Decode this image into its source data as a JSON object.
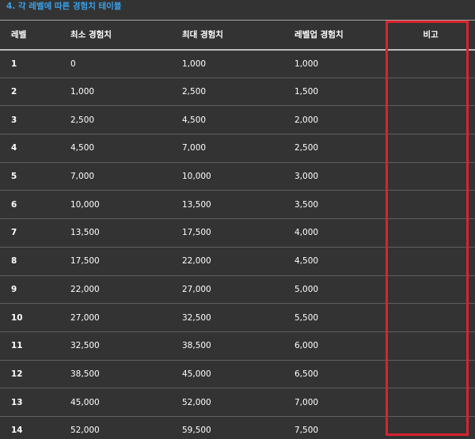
{
  "heading": "4. 각 레벨에 따른 경험치 테이블",
  "table": {
    "headers": {
      "level": "레벨",
      "min_exp": "최소 경험치",
      "max_exp": "최대 경험치",
      "levelup_exp": "레벨업 경험치",
      "note": "비고"
    },
    "rows": [
      {
        "level": "1",
        "min": "0",
        "max": "1,000",
        "up": "1,000"
      },
      {
        "level": "2",
        "min": "1,000",
        "max": "2,500",
        "up": "1,500"
      },
      {
        "level": "3",
        "min": "2,500",
        "max": "4,500",
        "up": "2,000"
      },
      {
        "level": "4",
        "min": "4,500",
        "max": "7,000",
        "up": "2,500"
      },
      {
        "level": "5",
        "min": "7,000",
        "max": "10,000",
        "up": "3,000"
      },
      {
        "level": "6",
        "min": "10,000",
        "max": "13,500",
        "up": "3,500"
      },
      {
        "level": "7",
        "min": "13,500",
        "max": "17,500",
        "up": "4,000"
      },
      {
        "level": "8",
        "min": "17,500",
        "max": "22,000",
        "up": "4,500"
      },
      {
        "level": "9",
        "min": "22,000",
        "max": "27,000",
        "up": "5,000"
      },
      {
        "level": "10",
        "min": "27,000",
        "max": "32,500",
        "up": "5,500"
      },
      {
        "level": "11",
        "min": "32,500",
        "max": "38,500",
        "up": "6,000"
      },
      {
        "level": "12",
        "min": "38,500",
        "max": "45,000",
        "up": "6,500"
      },
      {
        "level": "13",
        "min": "45,000",
        "max": "52,000",
        "up": "7,000"
      },
      {
        "level": "14",
        "min": "52,000",
        "max": "59,500",
        "up": "7,500"
      }
    ]
  },
  "colors": {
    "background": "#333333",
    "heading": "#3aa0e8",
    "highlight": "#d9232e"
  }
}
